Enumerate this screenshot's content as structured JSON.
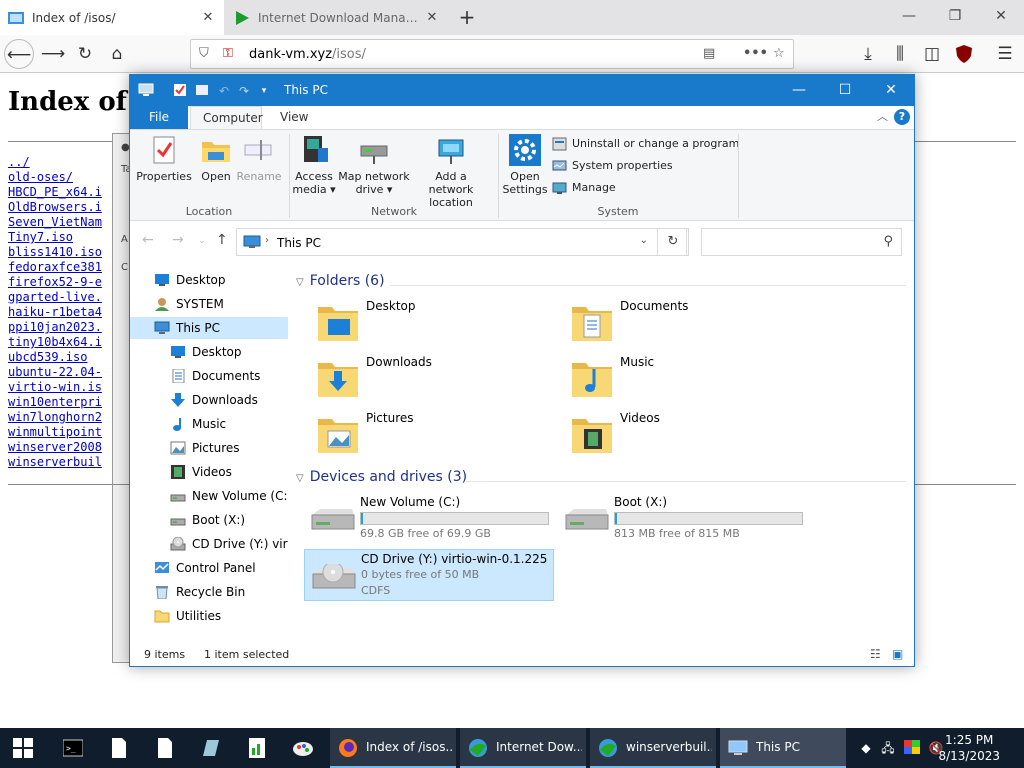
{
  "browser": {
    "tabs": [
      {
        "title": "Index of /isos/",
        "icon": "folder-page-icon",
        "active": true
      },
      {
        "title": "Internet Download Manager: T",
        "icon": "idm-play-icon",
        "active": false
      }
    ],
    "url_domain": "dank-vm.xyz",
    "url_path": "/isos/"
  },
  "page": {
    "heading": "Index of",
    "files": [
      "../",
      "old-oses/",
      "HBCD_PE_x64.i",
      "OldBrowsers.i",
      "Seven_VietNam",
      "Tiny7.iso",
      "bliss1410.iso",
      "fedoraxfce381",
      "firefox52-9-e",
      "gparted-live.",
      "haiku-r1beta4",
      "ppi10jan2023.",
      "tiny10b4x64.i",
      "ubcd539.iso",
      "ubuntu-22.04-",
      "virtio-win.is",
      "win10enterpri",
      "win7longhorn2",
      "winmultipoint",
      "winserver2008",
      "winserverbuil"
    ]
  },
  "explorer": {
    "title": "This PC",
    "ribbon_tabs": [
      "File",
      "Computer",
      "View"
    ],
    "ribbon": {
      "location": {
        "label": "Location",
        "buttons": [
          {
            "label": "Properties",
            "icon": "properties-icon"
          },
          {
            "label": "Open",
            "icon": "open-folder-icon"
          },
          {
            "label": "Rename",
            "icon": "rename-icon"
          }
        ]
      },
      "network": {
        "label": "Network",
        "buttons": [
          {
            "label1": "Access",
            "label2": "media ▾",
            "icon": "access-media-icon"
          },
          {
            "label1": "Map network",
            "label2": "drive ▾",
            "icon": "map-network-drive-icon"
          },
          {
            "label1": "Add a network",
            "label2": "location",
            "icon": "add-network-location-icon"
          }
        ]
      },
      "system": {
        "label": "System",
        "open_settings_1": "Open",
        "open_settings_2": "Settings",
        "commands": [
          "Uninstall or change a program",
          "System properties",
          "Manage"
        ]
      }
    },
    "address": "This PC",
    "nav_items": [
      {
        "label": "Desktop",
        "indent": 1,
        "icon": "desktop-icon"
      },
      {
        "label": "SYSTEM",
        "indent": 1,
        "icon": "user-icon"
      },
      {
        "label": "This PC",
        "indent": 1,
        "icon": "computer-icon",
        "selected": true
      },
      {
        "label": "Desktop",
        "indent": 2,
        "icon": "desktop-icon"
      },
      {
        "label": "Documents",
        "indent": 2,
        "icon": "documents-icon"
      },
      {
        "label": "Downloads",
        "indent": 2,
        "icon": "downloads-icon"
      },
      {
        "label": "Music",
        "indent": 2,
        "icon": "music-icon"
      },
      {
        "label": "Pictures",
        "indent": 2,
        "icon": "pictures-icon"
      },
      {
        "label": "Videos",
        "indent": 2,
        "icon": "videos-icon"
      },
      {
        "label": "New Volume (C:)",
        "indent": 2,
        "icon": "drive-icon"
      },
      {
        "label": "Boot (X:)",
        "indent": 2,
        "icon": "drive-icon"
      },
      {
        "label": "CD Drive (Y:) virtio",
        "indent": 2,
        "icon": "cd-drive-icon"
      },
      {
        "label": "Control Panel",
        "indent": 1,
        "icon": "control-panel-icon"
      },
      {
        "label": "Recycle Bin",
        "indent": 1,
        "icon": "recycle-bin-icon"
      },
      {
        "label": "Utilities",
        "indent": 1,
        "icon": "folder-icon"
      }
    ],
    "folders_header": "Folders (6)",
    "folders": [
      {
        "name": "Desktop",
        "icon": "desktop-folder-icon"
      },
      {
        "name": "Documents",
        "icon": "documents-folder-icon"
      },
      {
        "name": "Downloads",
        "icon": "downloads-folder-icon"
      },
      {
        "name": "Music",
        "icon": "music-folder-icon"
      },
      {
        "name": "Pictures",
        "icon": "pictures-folder-icon"
      },
      {
        "name": "Videos",
        "icon": "videos-folder-icon"
      }
    ],
    "drives_header": "Devices and drives (3)",
    "drives": [
      {
        "name": "New Volume (C:)",
        "free": "69.8 GB free of 69.9 GB",
        "used_fraction": 0.01,
        "icon": "hard-drive-icon"
      },
      {
        "name": "Boot (X:)",
        "free": "813 MB free of 815 MB",
        "used_fraction": 0.01,
        "icon": "hard-drive-icon"
      },
      {
        "name": "CD Drive (Y:) virtio-win-0.1.225",
        "free": "0 bytes free of 50 MB",
        "fs": "CDFS",
        "icon": "cd-drive-icon",
        "selected": true
      }
    ],
    "status": {
      "items": "9 items",
      "selected": "1 item selected"
    }
  },
  "taskbar": {
    "tasks": [
      {
        "label": "Index of /isos...",
        "icon": "firefox-icon"
      },
      {
        "label": "Internet Dow...",
        "icon": "idm-icon"
      },
      {
        "label": "winserverbuil...",
        "icon": "idm-icon"
      },
      {
        "label": "This PC",
        "icon": "this-pc-icon",
        "active": true
      }
    ],
    "time": "1:25 PM",
    "date": "8/13/2023"
  },
  "colors": {
    "accent": "#1979ca",
    "selection": "#cce8ff",
    "taskbar": "#101d2c",
    "link": "#0000cc"
  }
}
